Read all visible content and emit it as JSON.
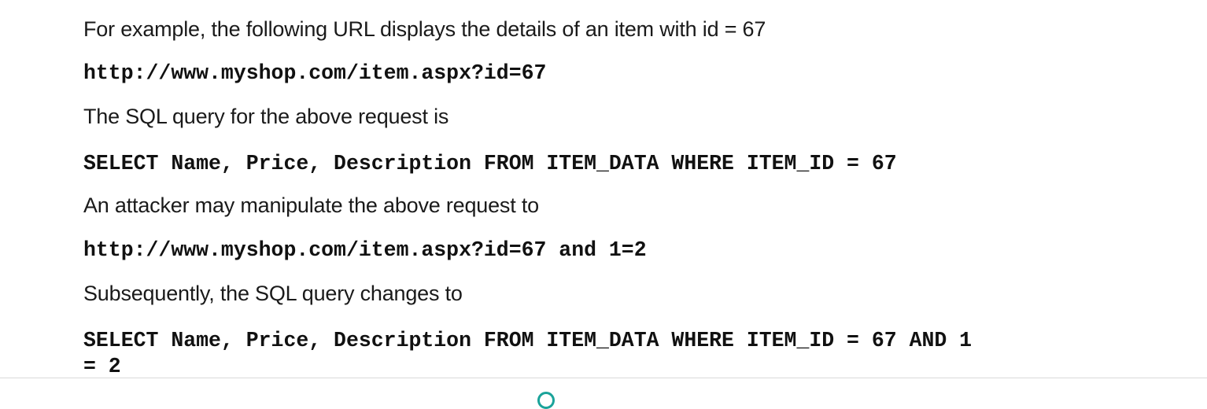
{
  "content": {
    "intro": "For example, the following URL displays the details of an item with id = 67",
    "url1": "http://www.myshop.com/item.aspx?id=67",
    "query_intro": "The SQL query for the above request is",
    "query1": "SELECT Name, Price, Description FROM ITEM_DATA WHERE ITEM_ID = 67",
    "attack_intro": "An attacker may manipulate the above request to",
    "url2": "http://www.myshop.com/item.aspx?id=67 and 1=2",
    "change_intro": "Subsequently, the SQL query changes to",
    "query2_line1": "SELECT Name, Price, Description FROM ITEM_DATA WHERE ITEM_ID = 67 AND 1",
    "query2_line2": "= 2"
  },
  "colors": {
    "text": "#1a1a1a",
    "divider": "#d9d9d9",
    "accent": "#1aa39a"
  }
}
